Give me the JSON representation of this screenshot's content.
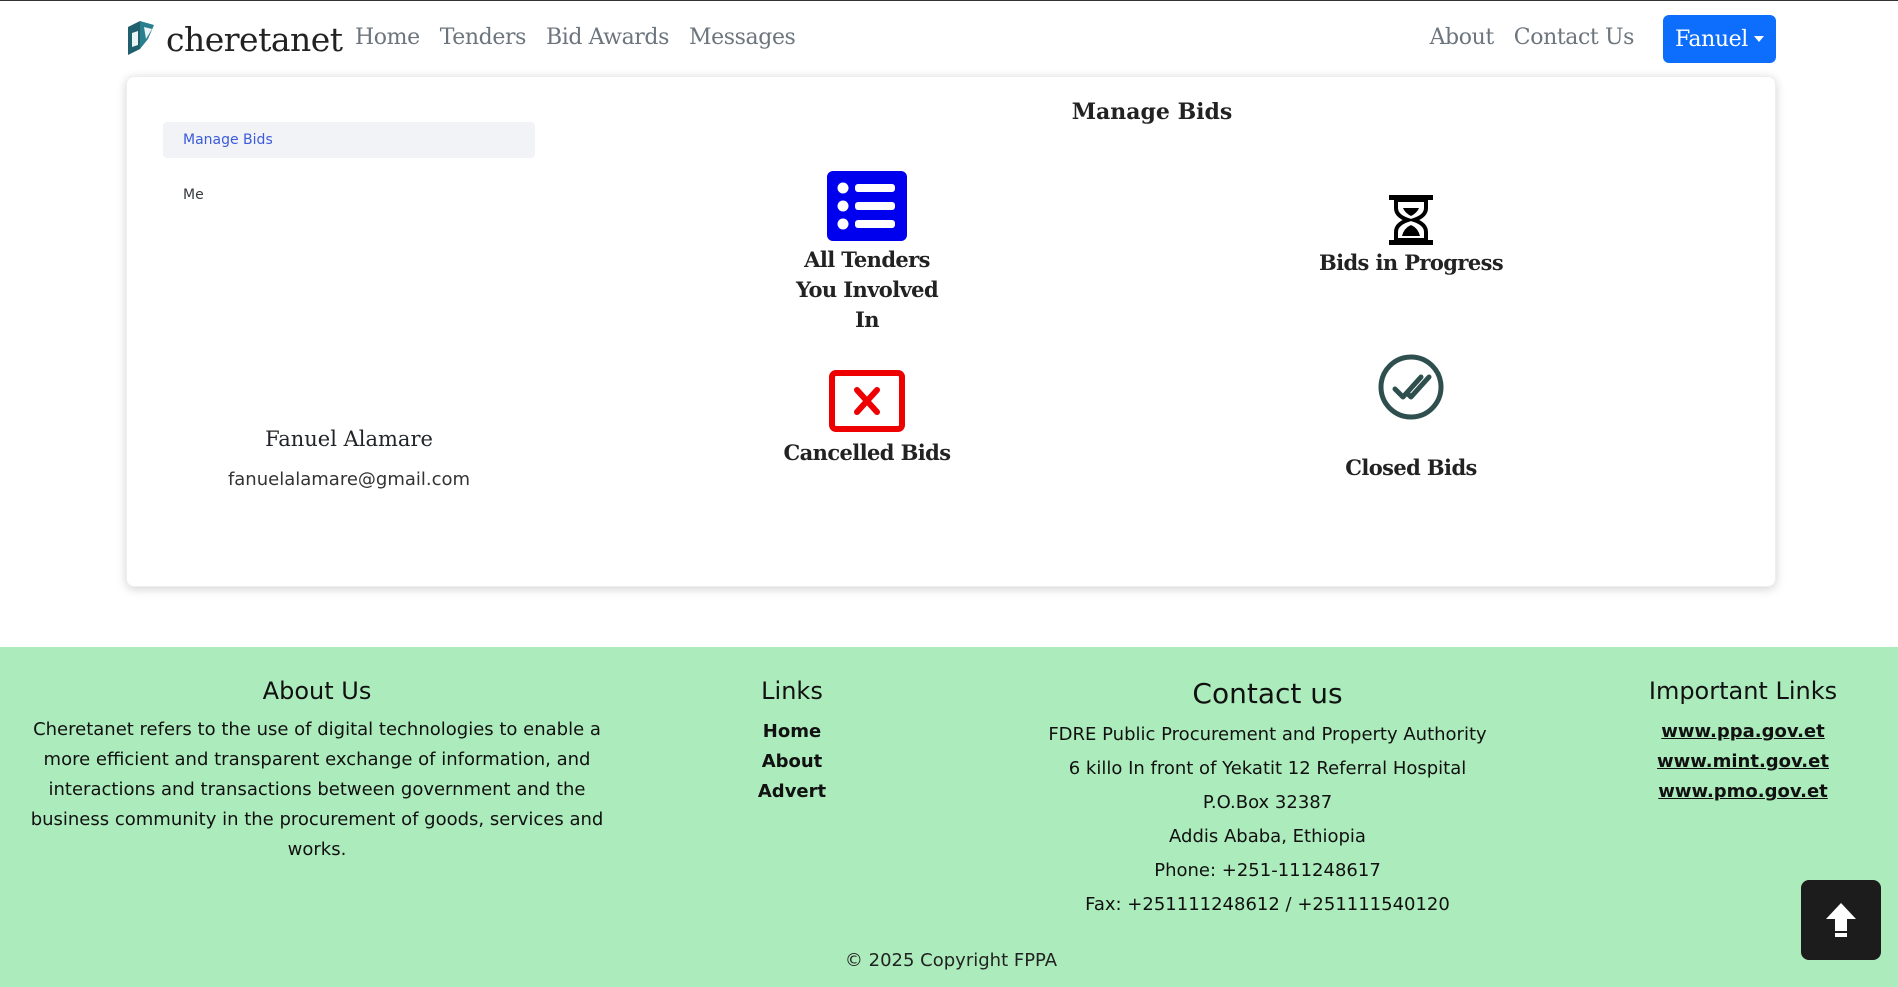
{
  "nav": {
    "brand": "cheretanet",
    "links": [
      "Home",
      "Tenders",
      "Bid Awards",
      "Messages"
    ],
    "right_links": [
      "About",
      "Contact Us"
    ],
    "user_button": "Fanuel"
  },
  "sidebar": {
    "items": [
      {
        "label": "Manage Bids",
        "active": true
      },
      {
        "label": "Me",
        "active": false
      }
    ],
    "user_name": "Fanuel Alamare",
    "user_email": "fanuelalamare@gmail.com"
  },
  "main": {
    "title": "Manage Bids",
    "tiles": [
      {
        "label": "All Tenders You Involved In",
        "icon": "list-icon",
        "color": "#0000ee"
      },
      {
        "label": "Bids in Progress",
        "icon": "hourglass-icon",
        "color": "#000000"
      },
      {
        "label": "Cancelled Bids",
        "icon": "x-square-icon",
        "color": "#ee0000"
      },
      {
        "label": "Closed Bids",
        "icon": "check-circle-icon",
        "color": "#2f4f4f"
      }
    ]
  },
  "footer": {
    "about": {
      "heading": "About Us",
      "text": "Cheretanet refers to the use of digital technologies to enable a more efficient and transparent exchange of information, and interactions and transactions between government and the business community in the procurement of goods, services and works."
    },
    "links": {
      "heading": "Links",
      "items": [
        "Home",
        "About",
        "Advert"
      ]
    },
    "contact": {
      "heading": "Contact us",
      "lines": [
        "FDRE Public Procurement and Property Authority",
        "6 killo In front of Yekatit 12 Referral Hospital",
        "P.O.Box 32387",
        "Addis Ababa, Ethiopia",
        "Phone: +251-111248617",
        "Fax: +251111248612 / +251111540120"
      ]
    },
    "important": {
      "heading": "Important Links",
      "items": [
        "www.ppa.gov.et",
        "www.mint.gov.et",
        "www.pmo.gov.et"
      ]
    },
    "copyright": "© 2025 Copyright FPPA"
  },
  "colors": {
    "primary": "#0d6efd",
    "footer_bg": "#acebbc"
  }
}
